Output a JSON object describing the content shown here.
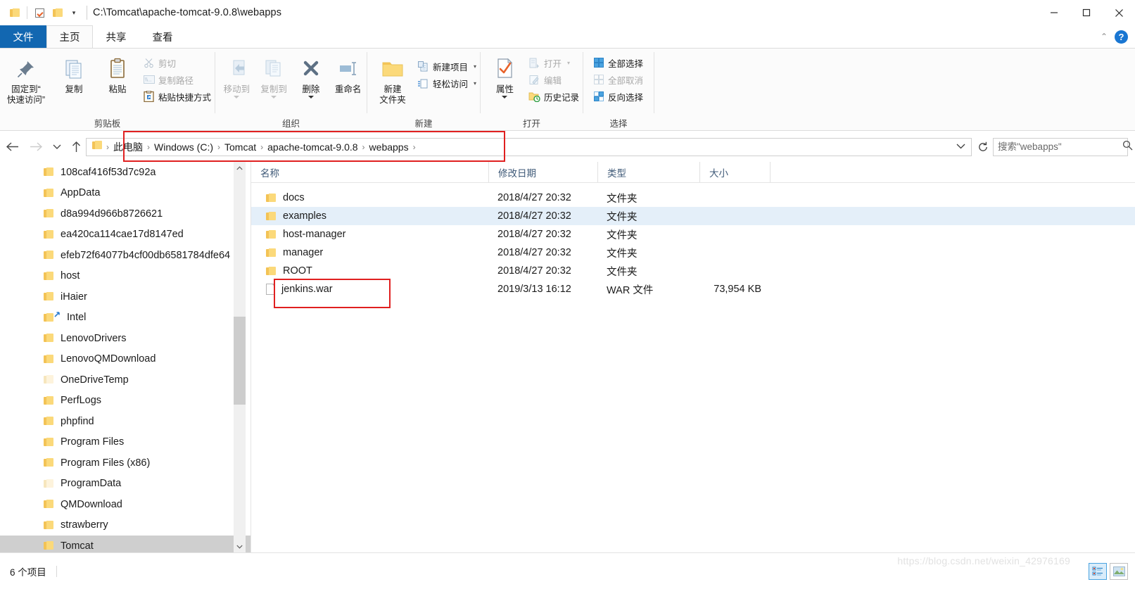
{
  "window": {
    "title_path": "C:\\Tomcat\\apache-tomcat-9.0.8\\webapps",
    "quick_access": {
      "folder_icon": "folder-icon",
      "properties_icon": "properties-checkbox-icon",
      "new_folder_icon": "new-folder-icon",
      "customize_caret": "▾"
    },
    "controls": {
      "minimize": "minimize-icon",
      "maximize": "maximize-icon",
      "close": "close-icon"
    }
  },
  "tabs": {
    "file": "文件",
    "items": [
      {
        "label": "主页",
        "active": true
      },
      {
        "label": "共享",
        "active": false
      },
      {
        "label": "查看",
        "active": false
      }
    ],
    "collapse_ribbon": "⌃",
    "help": "?"
  },
  "ribbon": {
    "groups": [
      {
        "name": "clipboard",
        "label": "剪贴板",
        "big": [
          {
            "label": "固定到“\n快速访问”",
            "line1": "固定到“",
            "line2": "快速访问”",
            "icon": "pin-icon",
            "dim": false
          },
          {
            "label": "复制",
            "icon": "copy-icon",
            "dim": false
          },
          {
            "label": "粘贴",
            "icon": "paste-clipboard-icon",
            "dim": false
          }
        ],
        "small": [
          {
            "label": "剪切",
            "icon": "scissors-icon",
            "dim": true
          },
          {
            "label": "复制路径",
            "icon": "copy-path-icon",
            "dim": true
          },
          {
            "label": "粘贴快捷方式",
            "icon": "paste-shortcut-icon",
            "dim": false
          }
        ]
      },
      {
        "name": "organize",
        "label": "组织",
        "big": [
          {
            "line1": "移动到",
            "icon": "move-to-icon",
            "dim": true,
            "caret": true
          },
          {
            "line1": "复制到",
            "icon": "copy-to-icon",
            "dim": true,
            "caret": true
          },
          {
            "line1": "删除",
            "icon": "delete-x-icon",
            "dim": false,
            "caret": true
          },
          {
            "line1": "重命名",
            "icon": "rename-icon",
            "dim": false,
            "caret": false
          }
        ]
      },
      {
        "name": "new",
        "label": "新建",
        "big": [
          {
            "line1": "新建",
            "line2": "文件夹",
            "icon": "new-folder-icon",
            "dim": false
          }
        ],
        "small": [
          {
            "label": "新建项目",
            "icon": "new-item-icon",
            "dim": false,
            "caret": true
          },
          {
            "label": "轻松访问",
            "icon": "easy-access-icon",
            "dim": false,
            "caret": true
          }
        ]
      },
      {
        "name": "open",
        "label": "打开",
        "big": [
          {
            "line1": "属性",
            "icon": "properties-icon",
            "dim": false,
            "caret": true
          }
        ],
        "small": [
          {
            "label": "打开",
            "icon": "open-icon",
            "dim": true,
            "caret": true
          },
          {
            "label": "编辑",
            "icon": "edit-icon",
            "dim": true
          },
          {
            "label": "历史记录",
            "icon": "history-icon",
            "dim": false
          }
        ]
      },
      {
        "name": "select",
        "label": "选择",
        "small": [
          {
            "label": "全部选择",
            "icon": "select-all-icon",
            "dim": false
          },
          {
            "label": "全部取消",
            "icon": "select-none-icon",
            "dim": true
          },
          {
            "label": "反向选择",
            "icon": "invert-selection-icon",
            "dim": false
          }
        ]
      }
    ]
  },
  "navbar": {
    "back": "back-arrow-icon",
    "forward": "forward-arrow-icon",
    "recent": "recent-locations-caret",
    "up": "up-arrow-icon",
    "breadcrumb_icon": "folder-icon",
    "breadcrumbs": [
      "此电脑",
      "Windows (C:)",
      "Tomcat",
      "apache-tomcat-9.0.8",
      "webapps"
    ],
    "separator": "›",
    "dropdown_caret": "⌄",
    "refresh": "refresh-icon",
    "search_placeholder": "搜索\"webapps\"",
    "search_value": "",
    "search_icon": "search-icon"
  },
  "navpane": {
    "items": [
      {
        "label": "108caf416f53d7c92a",
        "pale": false,
        "shortcut": false,
        "selected": false
      },
      {
        "label": "AppData",
        "pale": false,
        "shortcut": false,
        "selected": false
      },
      {
        "label": "d8a994d966b8726621",
        "pale": false,
        "shortcut": false,
        "selected": false
      },
      {
        "label": "ea420ca114cae17d8147ed",
        "pale": false,
        "shortcut": false,
        "selected": false
      },
      {
        "label": "efeb72f64077b4cf00db6581784dfe64",
        "pale": false,
        "shortcut": false,
        "selected": false
      },
      {
        "label": "host",
        "pale": false,
        "shortcut": false,
        "selected": false
      },
      {
        "label": "iHaier",
        "pale": false,
        "shortcut": false,
        "selected": false
      },
      {
        "label": "Intel",
        "pale": false,
        "shortcut": true,
        "selected": false
      },
      {
        "label": "LenovoDrivers",
        "pale": false,
        "shortcut": false,
        "selected": false
      },
      {
        "label": "LenovoQMDownload",
        "pale": false,
        "shortcut": false,
        "selected": false
      },
      {
        "label": "OneDriveTemp",
        "pale": true,
        "shortcut": false,
        "selected": false
      },
      {
        "label": "PerfLogs",
        "pale": false,
        "shortcut": false,
        "selected": false
      },
      {
        "label": "phpfind",
        "pale": false,
        "shortcut": false,
        "selected": false
      },
      {
        "label": "Program Files",
        "pale": false,
        "shortcut": false,
        "selected": false
      },
      {
        "label": "Program Files (x86)",
        "pale": false,
        "shortcut": false,
        "selected": false
      },
      {
        "label": "ProgramData",
        "pale": true,
        "shortcut": false,
        "selected": false
      },
      {
        "label": "QMDownload",
        "pale": false,
        "shortcut": false,
        "selected": false
      },
      {
        "label": "strawberry",
        "pale": false,
        "shortcut": false,
        "selected": false
      },
      {
        "label": "Tomcat",
        "pale": false,
        "shortcut": false,
        "selected": true
      }
    ],
    "scroll_up": "⌃",
    "scroll_down": "⌄"
  },
  "filelist": {
    "columns": [
      "名称",
      "修改日期",
      "类型",
      "大小"
    ],
    "rows": [
      {
        "name": "docs",
        "date": "2018/4/27 20:32",
        "type": "文件夹",
        "size": "",
        "icon": "folder-icon",
        "selected": false
      },
      {
        "name": "examples",
        "date": "2018/4/27 20:32",
        "type": "文件夹",
        "size": "",
        "icon": "folder-icon",
        "selected": true
      },
      {
        "name": "host-manager",
        "date": "2018/4/27 20:32",
        "type": "文件夹",
        "size": "",
        "icon": "folder-icon",
        "selected": false
      },
      {
        "name": "manager",
        "date": "2018/4/27 20:32",
        "type": "文件夹",
        "size": "",
        "icon": "folder-icon",
        "selected": false
      },
      {
        "name": "ROOT",
        "date": "2018/4/27 20:32",
        "type": "文件夹",
        "size": "",
        "icon": "folder-icon",
        "selected": false
      },
      {
        "name": "jenkins.war",
        "date": "2019/3/13 16:12",
        "type": "WAR 文件",
        "size": "73,954 KB",
        "icon": "document-icon",
        "selected": false
      }
    ]
  },
  "statusbar": {
    "item_count": "6 个项目",
    "details_view_icon": "details-view-icon",
    "thumbnail_view_icon": "large-icons-view-icon",
    "watermark": "https://blog.csdn.net/weixin_42976169"
  },
  "annotations": {
    "path_highlight": "red-rect-address-bar",
    "file_highlight": "red-rect-jenkins-war"
  },
  "colors": {
    "accent": "#1267b1",
    "selection": "#e4eff9",
    "nav_selection": "#cfcfcf",
    "annotation": "#e02020",
    "column_header_text": "#3f5a78"
  }
}
